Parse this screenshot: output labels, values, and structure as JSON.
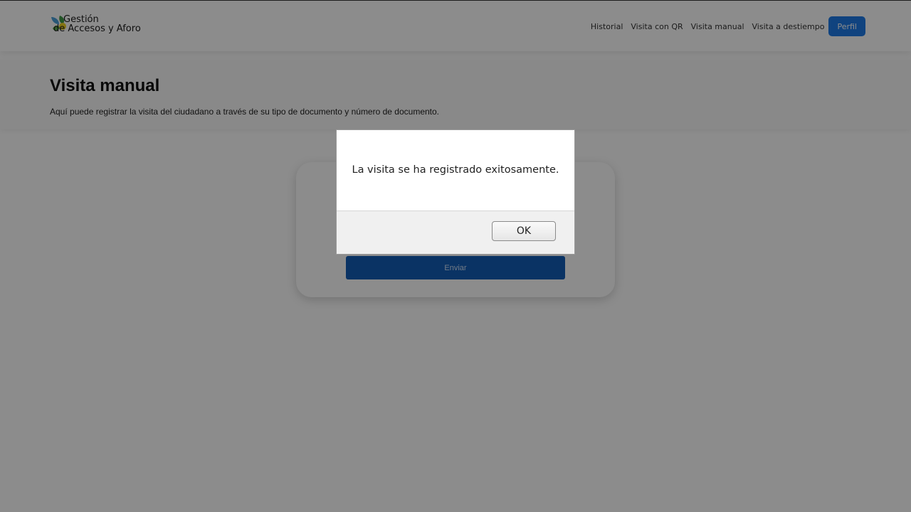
{
  "header": {
    "logo_line1": "Gestión",
    "logo_line2": "de Accesos y Aforo",
    "nav": [
      "Historial",
      "Visita con QR",
      "Visita manual",
      "Visita a destiempo"
    ],
    "profile_label": "Perfil"
  },
  "page": {
    "title": "Visita manual",
    "description": "Aquí puede registrar la visita del ciudadano a través de su tipo de documento y número de documento."
  },
  "form": {
    "submit_label": "Enviar"
  },
  "dialog": {
    "message": "La visita se ha registrado exitosamente.",
    "ok_label": "OK"
  },
  "colors": {
    "primary": "#1e7be8",
    "submit": "#135db6"
  }
}
